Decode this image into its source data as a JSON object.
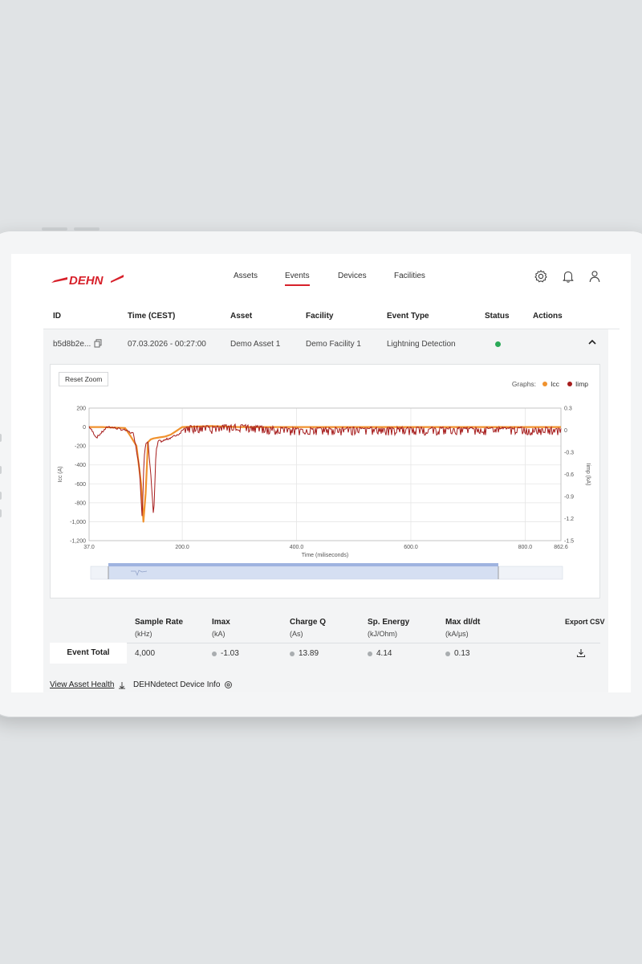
{
  "app": {
    "brand": "DEHN"
  },
  "nav": {
    "items": [
      "Assets",
      "Events",
      "Devices",
      "Facilities"
    ],
    "active": "Events"
  },
  "table": {
    "headers": [
      "ID",
      "Time (CEST)",
      "Asset",
      "Facility",
      "Event Type",
      "Status",
      "Actions"
    ],
    "row": {
      "id": "b5d8b2e...",
      "time": "07.03.2026 - 00:27:00",
      "asset": "Demo Asset 1",
      "facility": "Demo Facility 1",
      "event_type": "Lightning Detection",
      "status_color": "#2aa957"
    }
  },
  "chart": {
    "reset_label": "Reset Zoom",
    "graphs_label": "Graphs:",
    "legend": [
      {
        "name": "Icc",
        "color": "#f0922e"
      },
      {
        "name": "Iimp",
        "color": "#a61c1c"
      }
    ]
  },
  "chart_data": {
    "type": "line",
    "xlabel": "Time (miliseconds)",
    "ylabel_left": "Icc (A)",
    "ylabel_right": "Iimp (kA)",
    "xlim": [
      37.0,
      862.6
    ],
    "ylim_left": [
      -1200,
      200
    ],
    "ylim_right": [
      -1.5,
      0.3
    ],
    "x_ticks": [
      "37.0",
      "200.0",
      "400.0",
      "600.0",
      "800.0",
      "862.6"
    ],
    "y_ticks_left": [
      "200",
      "0",
      "-200",
      "-400",
      "-600",
      "-800",
      "-1,000",
      "-1,200"
    ],
    "y_ticks_right": [
      "0.3",
      "0",
      "-0.3",
      "-0.6",
      "-0.9",
      "-1.2",
      "-1.5"
    ],
    "series": [
      {
        "name": "Icc",
        "axis": "left",
        "x": [
          37,
          60,
          100,
          110,
          120,
          128,
          132,
          136,
          140,
          145,
          150,
          160,
          170,
          180,
          190,
          200,
          250,
          300,
          400,
          500,
          600,
          700,
          800,
          862.6
        ],
        "y": [
          0,
          0,
          -10,
          -100,
          -200,
          -600,
          -1000,
          -700,
          -160,
          -130,
          -120,
          -110,
          -100,
          -80,
          -40,
          0,
          10,
          0,
          0,
          0,
          0,
          0,
          0,
          0
        ]
      },
      {
        "name": "Iimp",
        "axis": "right",
        "x": [
          37,
          50,
          70,
          100,
          115,
          125,
          130,
          133,
          136,
          140,
          145,
          150,
          154,
          158,
          165,
          180,
          195,
          205,
          250,
          300,
          400,
          500,
          600,
          700,
          800,
          862.6
        ],
        "y": [
          0.05,
          -0.1,
          0.05,
          0,
          -0.05,
          -0.5,
          -1.2,
          -0.4,
          -0.2,
          -0.15,
          -0.6,
          -1.2,
          -0.3,
          -0.15,
          -0.15,
          -0.1,
          -0.05,
          0.05,
          0.05,
          0.07,
          0.02,
          0.03,
          0.03,
          0.03,
          0.03,
          0.03
        ]
      }
    ]
  },
  "summary": {
    "columns": [
      {
        "title": "Sample Rate",
        "unit": "(kHz)",
        "value": "4,000",
        "dot": false
      },
      {
        "title": "Imax",
        "unit": "(kA)",
        "value": "-1.03",
        "dot": true
      },
      {
        "title": "Charge Q",
        "unit": "(As)",
        "value": "13.89",
        "dot": true
      },
      {
        "title": "Sp. Energy",
        "unit": "(kJ/Ohm)",
        "value": "4.14",
        "dot": true
      },
      {
        "title": "Max dI/dt",
        "unit": "(kA/μs)",
        "value": "0.13",
        "dot": true
      }
    ],
    "row_label": "Event Total",
    "export_label": "Export CSV"
  },
  "footer": {
    "asset_health": "View Asset Health",
    "device_info": "DEHNdetect Device Info"
  }
}
